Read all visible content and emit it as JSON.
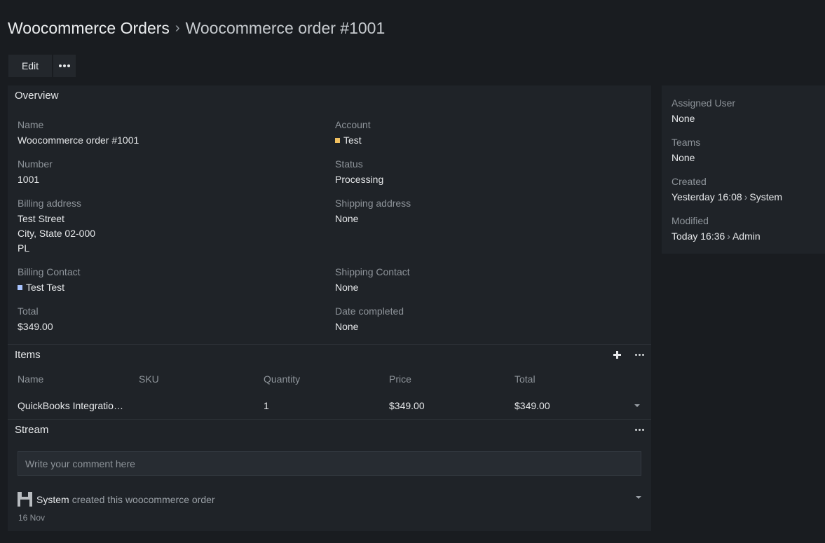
{
  "header": {
    "crumb": "Woocommerce Orders",
    "separator": "›",
    "title": "Woocommerce order #1001"
  },
  "toolbar": {
    "edit_label": "Edit"
  },
  "overview": {
    "title": "Overview",
    "fields": {
      "name": {
        "label": "Name",
        "value": "Woocommerce order #1001"
      },
      "account": {
        "label": "Account",
        "value": "Test",
        "color": "#f0c060"
      },
      "number": {
        "label": "Number",
        "value": "1001"
      },
      "status": {
        "label": "Status",
        "value": "Processing"
      },
      "billing_address": {
        "label": "Billing address",
        "lines": [
          "Test Street",
          "City, State 02-000",
          "PL"
        ]
      },
      "shipping_address": {
        "label": "Shipping address",
        "value": "None"
      },
      "billing_contact": {
        "label": "Billing Contact",
        "value": "Test Test",
        "color": "#a9c4ff"
      },
      "shipping_contact": {
        "label": "Shipping Contact",
        "value": "None"
      },
      "total": {
        "label": "Total",
        "value": "$349.00"
      },
      "date_completed": {
        "label": "Date completed",
        "value": "None"
      }
    }
  },
  "items": {
    "title": "Items",
    "columns": [
      "Name",
      "SKU",
      "Quantity",
      "Price",
      "Total"
    ],
    "rows": [
      {
        "name": "QuickBooks Integratio…",
        "sku": "",
        "quantity": "1",
        "price": "$349.00",
        "total": "$349.00"
      }
    ]
  },
  "stream": {
    "title": "Stream",
    "placeholder": "Write your comment here",
    "note": {
      "user": "System",
      "text": "created this woocommerce order",
      "date": "16 Nov"
    }
  },
  "side": {
    "assigned_user": {
      "label": "Assigned User",
      "value": "None"
    },
    "teams": {
      "label": "Teams",
      "value": "None"
    },
    "created": {
      "label": "Created",
      "date": "Yesterday 16:08",
      "by": "System"
    },
    "modified": {
      "label": "Modified",
      "date": "Today 16:36",
      "by": "Admin"
    },
    "arrow": "›"
  },
  "icons": {
    "more": "more-horizontal-icon",
    "add": "plus-icon",
    "caret": "caret-down-icon",
    "avatar": "system-avatar-icon"
  }
}
